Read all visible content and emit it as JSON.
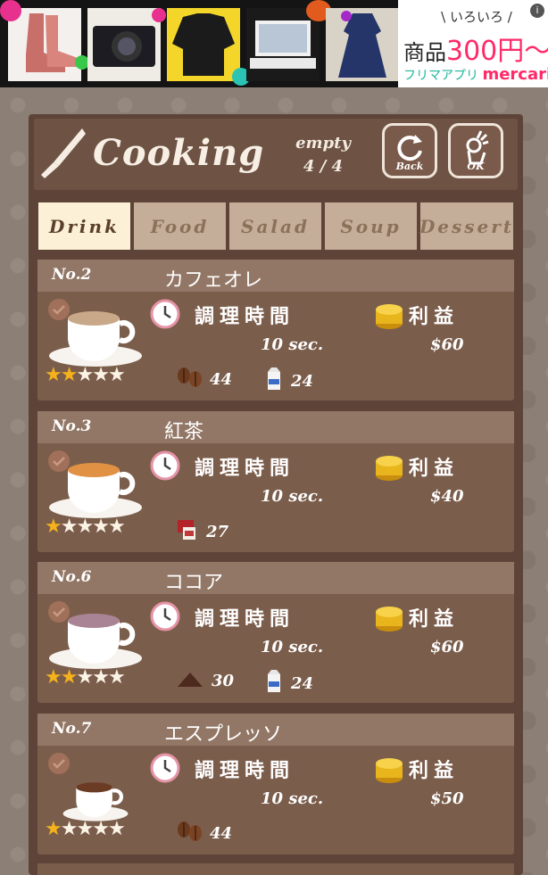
{
  "ad": {
    "tagline": "\\ いろいろ /",
    "price_prefix": "商品",
    "price_value": "300円〜",
    "app_name": "フリマアプリ",
    "brand": "mercari",
    "info": "i"
  },
  "header": {
    "title": "Cooking",
    "status_label": "empty",
    "status_count": "4 / 4",
    "back_label": "Back",
    "ok_label": "OK"
  },
  "tabs": [
    {
      "label": "Drink",
      "active": true
    },
    {
      "label": "Food",
      "active": false
    },
    {
      "label": "Salad",
      "active": false
    },
    {
      "label": "Soup",
      "active": false
    },
    {
      "label": "Dessert",
      "active": false
    }
  ],
  "labels": {
    "cook_time": "調理時間",
    "profit": "利益"
  },
  "recipes": [
    {
      "number": "No.2",
      "name": "カフェオレ",
      "time": "10 sec.",
      "profit": "$60",
      "stars": 2,
      "ingredients": [
        {
          "icon": "coffee-beans-icon",
          "count": "44"
        },
        {
          "icon": "milk-icon",
          "count": "24"
        }
      ]
    },
    {
      "number": "No.3",
      "name": "紅茶",
      "time": "10 sec.",
      "profit": "$40",
      "stars": 1,
      "ingredients": [
        {
          "icon": "tea-bag-icon",
          "count": "27"
        }
      ]
    },
    {
      "number": "No.6",
      "name": "ココア",
      "time": "10 sec.",
      "profit": "$60",
      "stars": 2,
      "ingredients": [
        {
          "icon": "cocoa-icon",
          "count": "30"
        },
        {
          "icon": "milk-icon",
          "count": "24"
        }
      ]
    },
    {
      "number": "No.7",
      "name": "エスプレッソ",
      "time": "10 sec.",
      "profit": "$50",
      "stars": 1,
      "ingredients": [
        {
          "icon": "coffee-beans-icon",
          "count": "44"
        }
      ]
    }
  ],
  "colors": {
    "panel": "#5e4438",
    "card": "#7b5d4b",
    "tab_active": "#fcf0d6",
    "tab": "#c4ae9a",
    "star": "#f5b21c"
  }
}
